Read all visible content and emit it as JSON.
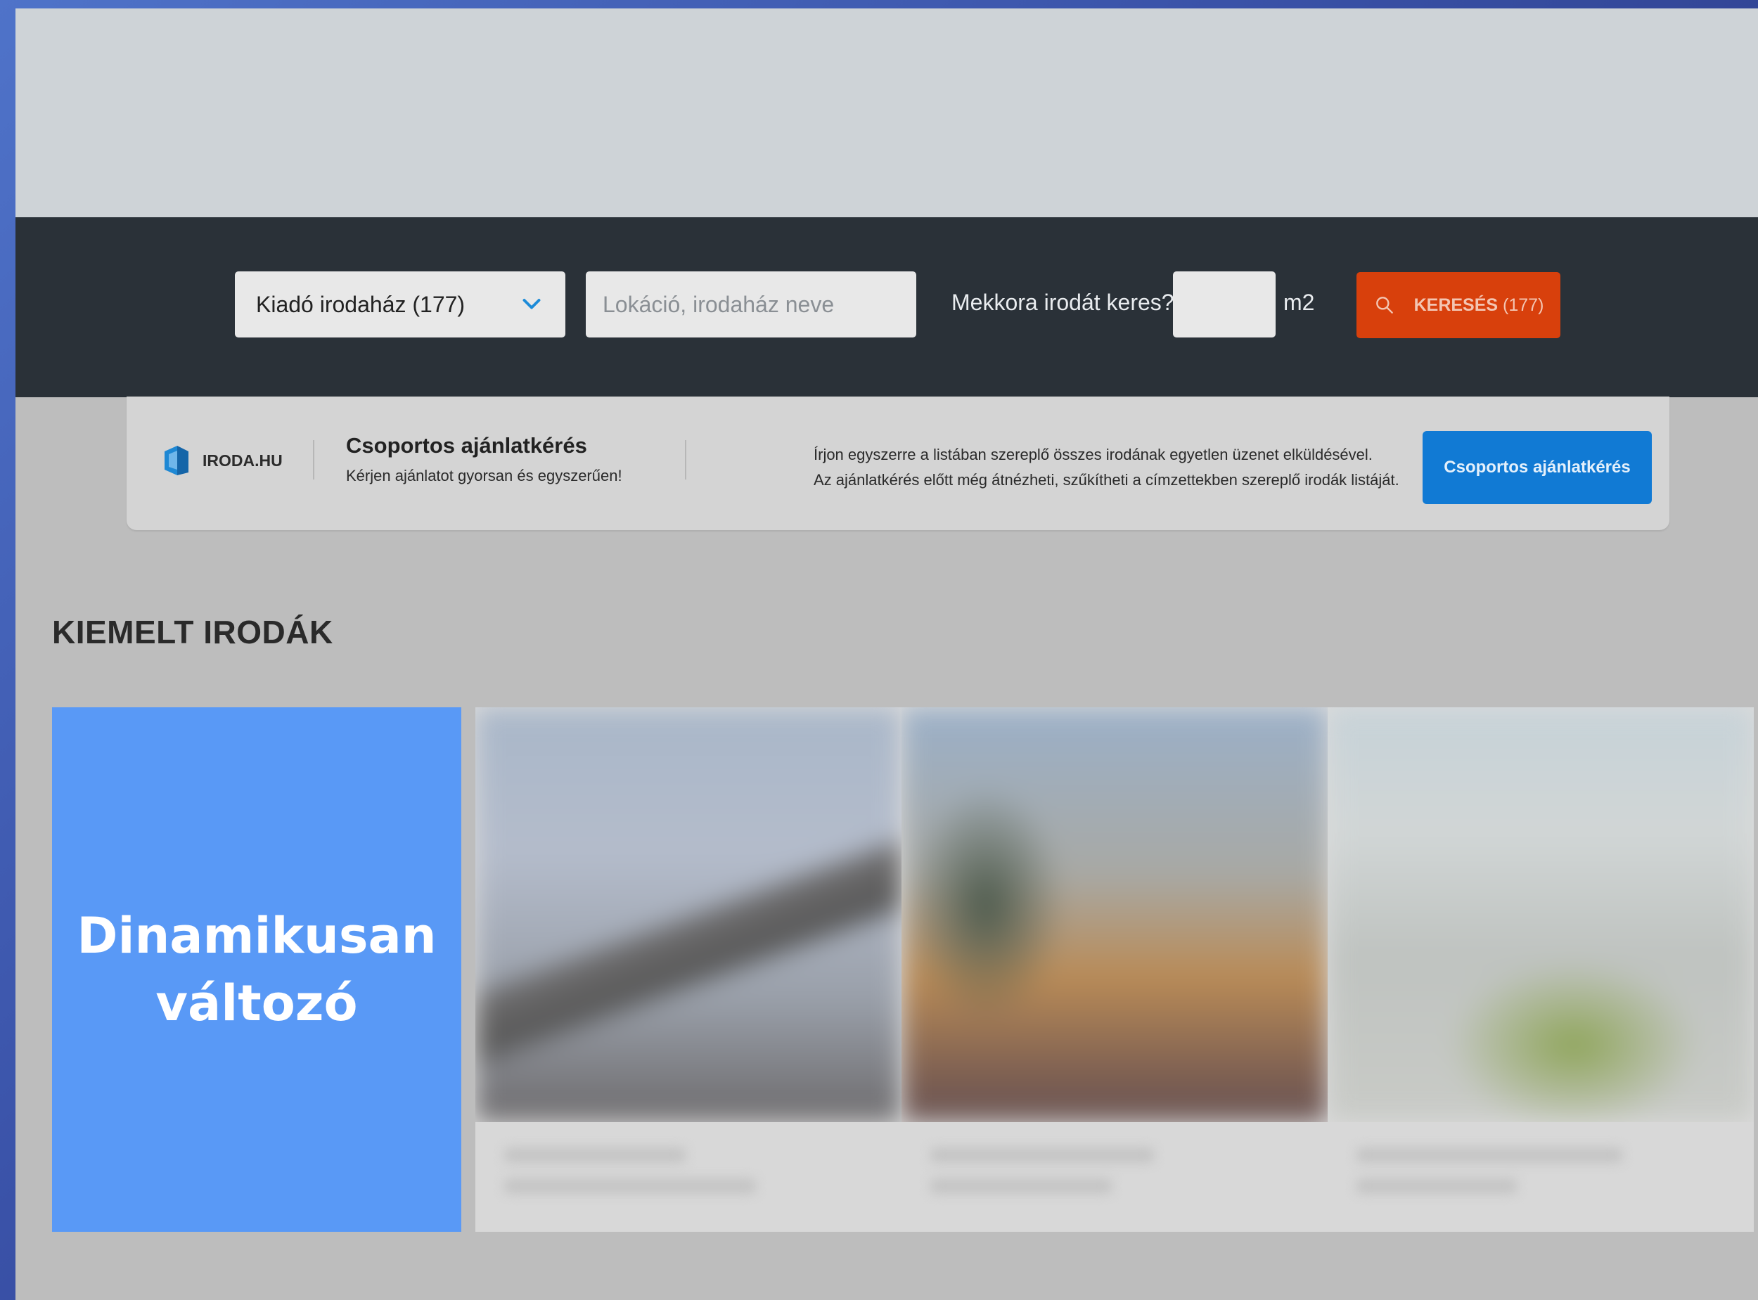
{
  "colors": {
    "search_bar_bg": "#2a3138",
    "search_button": "#d8400c",
    "promo_button": "#117ad4",
    "highlight_box": "#5999f6",
    "chevron": "#1c8bd8"
  },
  "search": {
    "type_select": "Kiadó irodaház (177)",
    "location_placeholder": "Lokáció, irodaház neve",
    "size_question": "Mekkora irodát keres?",
    "size_value": "",
    "size_unit": "m2",
    "button_label": "KERESÉS",
    "button_count": "(177)",
    "icons": {
      "select": "chevron-down-icon",
      "button": "search-icon"
    }
  },
  "promo": {
    "logo_text": "IRODA.HU",
    "title": "Csoportos ajánlatkérés",
    "subtitle": "Kérjen ajánlatot gyorsan és egyszerűen!",
    "description_line1": "Írjon egyszerre a listában szereplő összes irodának egyetlen üzenet elküldésével.",
    "description_line2": "Az ajánlatkérés előtt még átnézheti, szűkítheti a címzettekben szereplő irodák listáját.",
    "button_label": "Csoportos ajánlatkérés"
  },
  "featured": {
    "section_title": "KIEMELT IRODÁK",
    "dynamic_label": "Dinamikusan változó"
  }
}
